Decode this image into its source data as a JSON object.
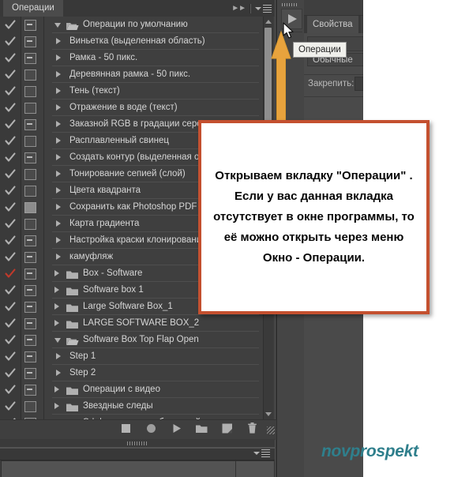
{
  "panel": {
    "tab_label": "Операции",
    "collapse_icon": "double-arrow-right-icon",
    "menu_icon": "panel-menu-icon",
    "rows": [
      {
        "label": "Операции по умолчанию",
        "check": "gray",
        "toggle": "dash",
        "arrow": "open",
        "folder": true,
        "indent": 0
      },
      {
        "label": "Виньетка (выделенная область)",
        "check": "gray",
        "toggle": "dash",
        "arrow": "closed",
        "folder": false,
        "indent": 1
      },
      {
        "label": "Рамка - 50 пикс.",
        "check": "gray",
        "toggle": "dash",
        "arrow": "closed",
        "folder": false,
        "indent": 1
      },
      {
        "label": "Деревянная рамка - 50 пикс.",
        "check": "gray",
        "toggle": "empty",
        "arrow": "closed",
        "folder": false,
        "indent": 1
      },
      {
        "label": "Тень (текст)",
        "check": "gray",
        "toggle": "empty",
        "arrow": "closed",
        "folder": false,
        "indent": 1
      },
      {
        "label": "Отражение в воде (текст)",
        "check": "gray",
        "toggle": "empty",
        "arrow": "closed",
        "folder": false,
        "indent": 1
      },
      {
        "label": "Заказной RGB в градации серого",
        "check": "gray",
        "toggle": "dash",
        "arrow": "closed",
        "folder": false,
        "indent": 1
      },
      {
        "label": "Расплавленный свинец",
        "check": "gray",
        "toggle": "empty",
        "arrow": "closed",
        "folder": false,
        "indent": 1
      },
      {
        "label": "Создать контур (выделенная обл",
        "check": "gray",
        "toggle": "dash",
        "arrow": "closed",
        "folder": false,
        "indent": 1
      },
      {
        "label": "Тонирование сепией (слой)",
        "check": "gray",
        "toggle": "empty",
        "arrow": "closed",
        "folder": false,
        "indent": 1
      },
      {
        "label": "Цвета квадранта",
        "check": "gray",
        "toggle": "empty",
        "arrow": "closed",
        "folder": false,
        "indent": 1
      },
      {
        "label": "Сохранить как Photoshop PDF",
        "check": "gray",
        "toggle": "solid",
        "arrow": "closed",
        "folder": false,
        "indent": 1
      },
      {
        "label": "Карта градиента",
        "check": "gray",
        "toggle": "empty",
        "arrow": "closed",
        "folder": false,
        "indent": 1
      },
      {
        "label": "Настройка краски клонирования",
        "check": "gray",
        "toggle": "dash",
        "arrow": "closed",
        "folder": false,
        "indent": 1
      },
      {
        "label": "камуфляж",
        "check": "gray",
        "toggle": "dash",
        "arrow": "closed",
        "folder": false,
        "indent": 1
      },
      {
        "label": "Box - Software",
        "check": "red",
        "toggle": "dash",
        "arrow": "closed",
        "folder": true,
        "indent": 0
      },
      {
        "label": "Software box 1",
        "check": "gray",
        "toggle": "dash",
        "arrow": "closed",
        "folder": true,
        "indent": 0
      },
      {
        "label": "Large Software Box_1",
        "check": "gray",
        "toggle": "dash",
        "arrow": "closed",
        "folder": true,
        "indent": 0
      },
      {
        "label": "LARGE SOFTWARE BOX_2",
        "check": "gray",
        "toggle": "dash",
        "arrow": "closed",
        "folder": true,
        "indent": 0
      },
      {
        "label": "Software Box Top Flap Open",
        "check": "gray",
        "toggle": "dash",
        "arrow": "open",
        "folder": true,
        "indent": 0
      },
      {
        "label": "Step 1",
        "check": "gray",
        "toggle": "dash",
        "arrow": "closed",
        "folder": false,
        "indent": 1
      },
      {
        "label": "Step 2",
        "check": "gray",
        "toggle": "dash",
        "arrow": "closed",
        "folder": false,
        "indent": 1
      },
      {
        "label": "Операции с видео",
        "check": "gray",
        "toggle": "dash",
        "arrow": "closed",
        "folder": true,
        "indent": 0
      },
      {
        "label": "Звездные следы",
        "check": "gray",
        "toggle": "empty",
        "arrow": "closed",
        "folder": true,
        "indent": 0
      },
      {
        "label": "Эффекты для изображений",
        "check": "gray",
        "toggle": "empty",
        "arrow": "closed",
        "folder": true,
        "indent": 0
      }
    ],
    "footer_buttons": [
      {
        "name": "stop-button",
        "icon": "stop-square-icon"
      },
      {
        "name": "record-button",
        "icon": "record-circle-icon"
      },
      {
        "name": "play-button",
        "icon": "play-triangle-icon"
      },
      {
        "name": "new-set-button",
        "icon": "folder-icon"
      },
      {
        "name": "new-action-button",
        "icon": "new-page-icon"
      },
      {
        "name": "delete-button",
        "icon": "trash-icon"
      }
    ],
    "scrollbar": {
      "up_icon": "scroll-up-arrow-icon",
      "down_icon": "scroll-down-arrow-icon"
    }
  },
  "dock": {
    "button_icon": "actions-play-icon",
    "tooltip": "Операции"
  },
  "properties": {
    "tab_label": "Свойства",
    "preset_value": "Обычные",
    "lock_label": "Закрепить:"
  },
  "callout": {
    "lines": [
      "Открываем вкладку \"Операции\" .",
      "Если у вас данная вкладка",
      "отсутствует в окне программы, то",
      "её можно открыть через меню",
      "Окно - Операции."
    ],
    "border_color": "#c4502f"
  },
  "annotation": {
    "arrow_icon": "up-arrow-icon",
    "arrow_color": "#e8a33d",
    "cursor_icon": "mouse-pointer-icon"
  },
  "watermark": {
    "part1": "nov",
    "part2": "prospekt",
    "color": "#2f7f8c"
  }
}
